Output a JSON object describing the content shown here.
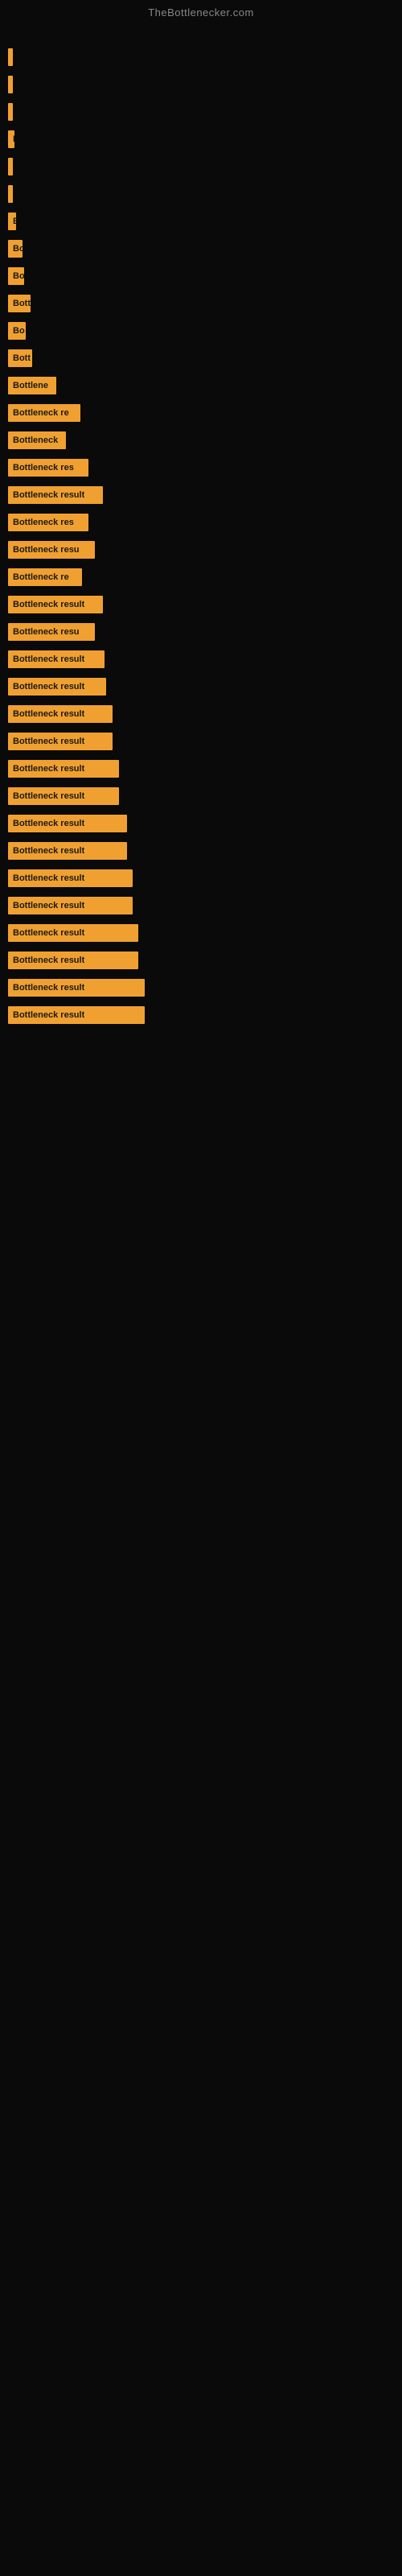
{
  "site": {
    "title": "TheBottlenecker.com"
  },
  "bars": [
    {
      "id": 1,
      "label": "|",
      "width": 4
    },
    {
      "id": 2,
      "label": "|",
      "width": 6
    },
    {
      "id": 3,
      "label": "|",
      "width": 6
    },
    {
      "id": 4,
      "label": "B",
      "width": 8
    },
    {
      "id": 5,
      "label": "|",
      "width": 6
    },
    {
      "id": 6,
      "label": "|",
      "width": 6
    },
    {
      "id": 7,
      "label": "B",
      "width": 10
    },
    {
      "id": 8,
      "label": "Bo",
      "width": 18
    },
    {
      "id": 9,
      "label": "Bo",
      "width": 20
    },
    {
      "id": 10,
      "label": "Bott",
      "width": 28
    },
    {
      "id": 11,
      "label": "Bo",
      "width": 22
    },
    {
      "id": 12,
      "label": "Bott",
      "width": 30
    },
    {
      "id": 13,
      "label": "Bottlene",
      "width": 60
    },
    {
      "id": 14,
      "label": "Bottleneck re",
      "width": 90
    },
    {
      "id": 15,
      "label": "Bottleneck",
      "width": 72
    },
    {
      "id": 16,
      "label": "Bottleneck res",
      "width": 100
    },
    {
      "id": 17,
      "label": "Bottleneck result",
      "width": 118
    },
    {
      "id": 18,
      "label": "Bottleneck res",
      "width": 100
    },
    {
      "id": 19,
      "label": "Bottleneck resu",
      "width": 108
    },
    {
      "id": 20,
      "label": "Bottleneck re",
      "width": 92
    },
    {
      "id": 21,
      "label": "Bottleneck result",
      "width": 118
    },
    {
      "id": 22,
      "label": "Bottleneck resu",
      "width": 108
    },
    {
      "id": 23,
      "label": "Bottleneck result",
      "width": 120
    },
    {
      "id": 24,
      "label": "Bottleneck result",
      "width": 122
    },
    {
      "id": 25,
      "label": "Bottleneck result",
      "width": 130
    },
    {
      "id": 26,
      "label": "Bottleneck result",
      "width": 130
    },
    {
      "id": 27,
      "label": "Bottleneck result",
      "width": 138
    },
    {
      "id": 28,
      "label": "Bottleneck result",
      "width": 138
    },
    {
      "id": 29,
      "label": "Bottleneck result",
      "width": 148
    },
    {
      "id": 30,
      "label": "Bottleneck result",
      "width": 148
    },
    {
      "id": 31,
      "label": "Bottleneck result",
      "width": 155
    },
    {
      "id": 32,
      "label": "Bottleneck result",
      "width": 155
    },
    {
      "id": 33,
      "label": "Bottleneck result",
      "width": 162
    },
    {
      "id": 34,
      "label": "Bottleneck result",
      "width": 162
    },
    {
      "id": 35,
      "label": "Bottleneck result",
      "width": 170
    },
    {
      "id": 36,
      "label": "Bottleneck result",
      "width": 170
    }
  ]
}
